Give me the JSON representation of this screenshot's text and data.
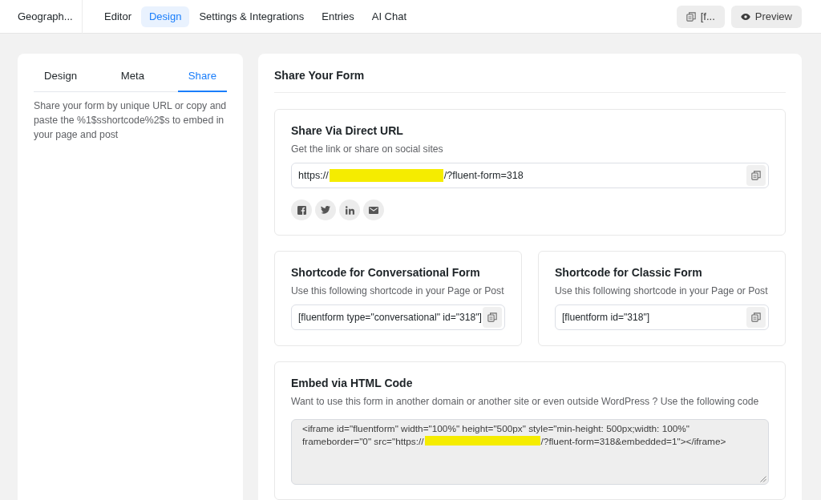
{
  "top_bar": {
    "form_title": "Geograph...",
    "tabs": [
      {
        "label": "Editor",
        "selected": false
      },
      {
        "label": "Design",
        "selected": true
      },
      {
        "label": "Settings & Integrations",
        "selected": false
      },
      {
        "label": "Entries",
        "selected": false
      },
      {
        "label": "AI Chat",
        "selected": false
      }
    ],
    "shortcode_button": "[f...",
    "preview_button": "Preview"
  },
  "sidebar": {
    "tabs": [
      {
        "label": "Design",
        "selected": false
      },
      {
        "label": "Meta",
        "selected": false
      },
      {
        "label": "Share",
        "selected": true
      }
    ],
    "description": "Share your form by unique URL or copy and paste the %1$sshortcode%2$s to embed in your page and post"
  },
  "main": {
    "title": "Share Your Form",
    "direct_url": {
      "title": "Share Via Direct URL",
      "subtitle": "Get the link or share on social sites",
      "value_before": "https://",
      "redacted": true,
      "value_after": "/?fluent-form=318"
    },
    "shortcodes": [
      {
        "title": "Shortcode for Conversational Form",
        "subtitle": "Use this following shortcode in your Page or Post",
        "value": "[fluentform type=\"conversational\" id=\"318\"]"
      },
      {
        "title": "Shortcode for Classic Form",
        "subtitle": "Use this following shortcode in your Page or Post",
        "value": "[fluentform id=\"318\"]"
      }
    ],
    "embed_code": {
      "title": "Embed via HTML Code",
      "subtitle": "Want to use this form in another domain or another site or even outside WordPress ? Use the following code",
      "value_before": "<iframe id=\"fluentform\" width=\"100%\" height=\"500px\" style=\"min-height: 500px;width: 100%\" frameborder=\"0\" src=\"https://",
      "redacted": true,
      "value_after": "/?fluent-form=318&embedded=1\"></iframe>"
    }
  }
}
